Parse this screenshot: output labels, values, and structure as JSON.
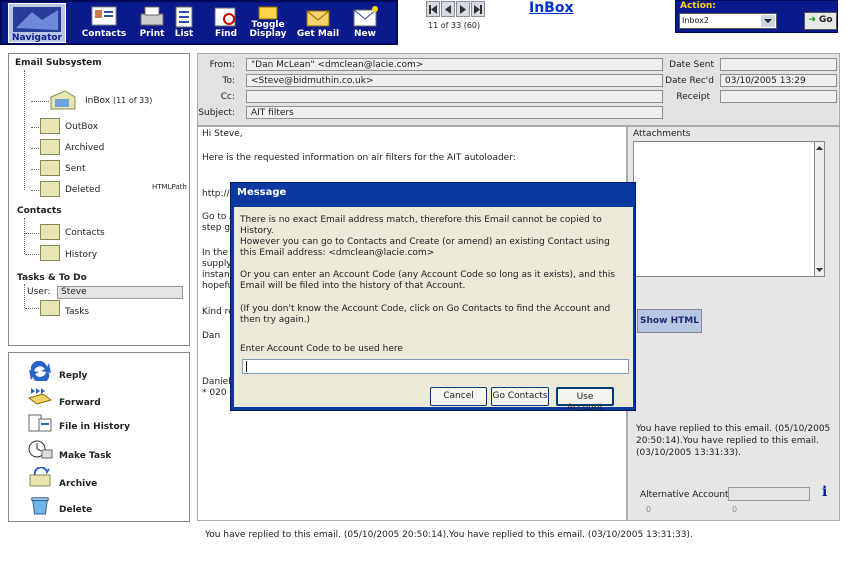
{
  "toolbar": {
    "navigator": "Navigator",
    "contacts": "Contacts",
    "print": "Print",
    "list": "List",
    "find": "Find",
    "toggle_display_1": "Toggle",
    "toggle_display_2": "Display",
    "get_mail": "Get Mail",
    "new": "New"
  },
  "pager": {
    "text": "11 of 33 (60)"
  },
  "title": "InBox",
  "action": {
    "label": "Action:",
    "selected": "Inbox2",
    "go": "Go"
  },
  "nav": {
    "email_subsystem": "Email Subsystem",
    "inbox": "InBox",
    "inbox_count": "(11 of 33)",
    "outbox": "OutBox",
    "archived": "Archived",
    "sent": "Sent",
    "deleted": "Deleted",
    "html_path": "HTMLPath",
    "contacts_section": "Contacts",
    "contacts": "Contacts",
    "history": "History",
    "tasks_section": "Tasks & To Do",
    "user_label": "User:",
    "user_value": "Steve",
    "tasks": "Tasks"
  },
  "actions": {
    "reply": "Reply",
    "forward": "Forward",
    "file_in_history": "File in History",
    "make_task": "Make Task",
    "archive": "Archive",
    "delete": "Delete"
  },
  "header": {
    "from_label": "From:",
    "from": "\"Dan McLean\" <dmclean@lacie.com>",
    "to_label": "To:",
    "to": "<Steve@bidmuthin.co.uk>",
    "cc_label": "Cc:",
    "cc": "",
    "subject_label": "Subject:",
    "subject": "AIT filters",
    "date_sent_label": "Date Sent",
    "date_sent": "",
    "date_recd_label": "Date Rec'd",
    "date_recd": "03/10/2005 13:29",
    "receipt_label": "Receipt",
    "receipt": ""
  },
  "body": {
    "l1": "Hi Steve,",
    "l2": "Here is the requested information on air filters for the AIT autoloader:",
    "l3": "http://s",
    "l4": "Go to A",
    "l5": "step gu",
    "l6": "In the n",
    "l7": "supply",
    "l8": "instanc",
    "l9": "hopefu",
    "l10": "Kind re",
    "l11": "Dan",
    "l12": "Daniel",
    "l13": "* 020 7"
  },
  "attachments": {
    "label": "Attachments",
    "show_html": "Show HTML"
  },
  "replied_right": "You have replied to this email.  (05/10/2005 20:50:14).You have replied to this email.  (03/10/2005 13:31:33).",
  "alt_account": {
    "label": "Alternative Account",
    "zero_a": "0",
    "zero_b": "0"
  },
  "footer": "You have replied to this email.  (05/10/2005 20:50:14).You have replied to this email.  (03/10/2005 13:31:33).",
  "dialog": {
    "title": "Message",
    "p1": "There is no exact Email address match, therefore this Email cannot be copied to History.",
    "p2": "However you can go to Contacts and Create (or amend) an existing Contact using this Email address:  <dmclean@lacie.com>",
    "p3": "Or you can enter an Account Code (any Account Code so long as it exists), and this Email will be filed into the history of that Account.",
    "p4": "(If you don't know the Account Code, click on Go Contacts to find the Account and then try again.)",
    "prompt": "Enter Account Code to be used here",
    "input_value": "",
    "cancel": "Cancel",
    "go_contacts": "Go Contacts",
    "use_account": "Use Account"
  },
  "colors": {
    "toolbar": "#0a1a8c",
    "dialog_title": "#0a3aa0",
    "dialog_body": "#ece9d8",
    "action_label": "#ffd700"
  }
}
